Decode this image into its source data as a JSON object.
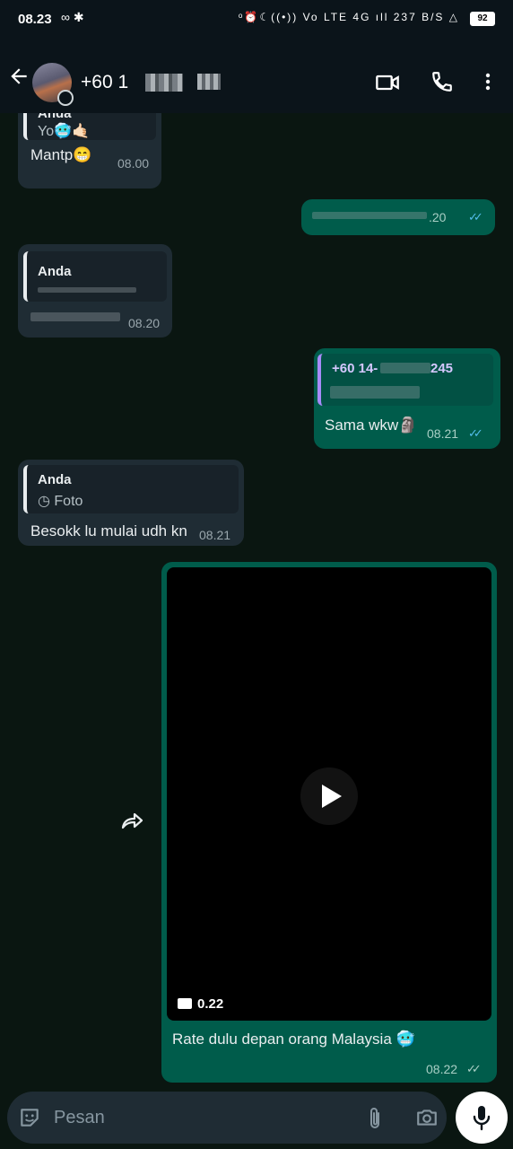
{
  "status": {
    "time": "08.23",
    "left_icons": "∞ ✱",
    "right_icons": "ᵒ⏰☾((•)) Vo LTE 4G ıll 237 B/S △",
    "battery": "92"
  },
  "header": {
    "contact_name": "+60 1",
    "icons": [
      "back-arrow-icon",
      "video-call-icon",
      "phone-icon",
      "more-vert-icon"
    ]
  },
  "messages": [
    {
      "quote_name": "Anda",
      "quote_text": "Yo🥶🤙🏻",
      "text": "Mantp😁",
      "time": "08.00"
    },
    {
      "time": ".20"
    },
    {
      "quote_name": "Anda",
      "time": "08.20"
    },
    {
      "quote_name": "+60 14-",
      "quote_name_end": "245",
      "text": "Sama wkw🗿",
      "time": "08.21"
    },
    {
      "quote_name": "Anda",
      "quote_text": "◷ Foto",
      "text": "Besokk lu mulai udh kn",
      "time": "08.21"
    },
    {
      "video_duration": "0.22",
      "text": "Rate dulu depan orang Malaysia 🥶",
      "time": "08.22"
    }
  ],
  "input": {
    "placeholder": "Pesan",
    "icons": [
      "sticker-icon",
      "attach-icon",
      "camera-icon",
      "mic-icon"
    ]
  },
  "colors": {
    "incoming_bubble": "#1f2c34",
    "outgoing_bubble": "#005c4b",
    "read_ticks": "#53bdeb",
    "header": "#0b141a"
  }
}
